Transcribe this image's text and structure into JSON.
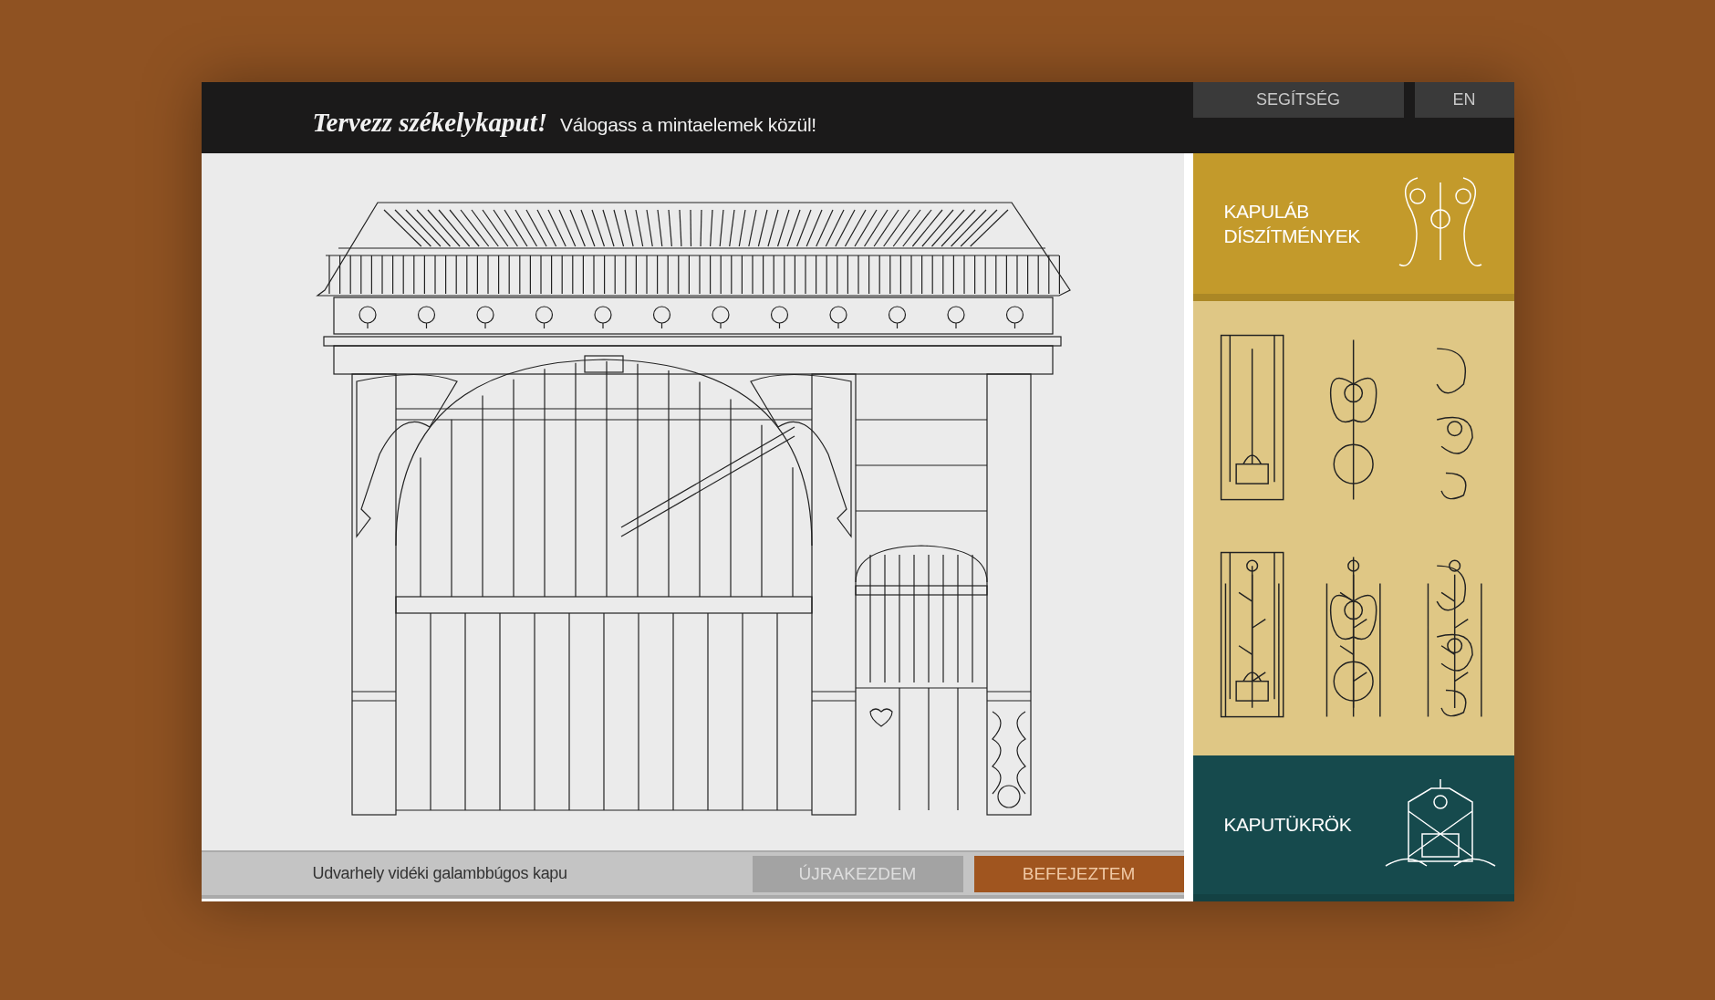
{
  "header": {
    "title": "Tervezz székelykaput!",
    "subtitle": "Válogass a mintaelemek közül!",
    "buttons": [
      {
        "label": "SEGÍTSÉG",
        "kind": "help"
      },
      {
        "label": "EN",
        "kind": "language"
      }
    ]
  },
  "canvas": {
    "gate_name": "Udvarhely vidéki galambbúgos kapu",
    "actions": [
      {
        "label": "ÚJRAKEZDEM",
        "kind": "secondary"
      },
      {
        "label": "BEFEJEZTEM",
        "kind": "primary"
      }
    ]
  },
  "sidebar": [
    {
      "kind": "category",
      "label": "KAPULÁB DÍSZÍTMÉNYEK",
      "color": "#c39a2b"
    },
    {
      "kind": "patterns",
      "color": "#dfc785"
    },
    {
      "kind": "category",
      "label": "KAPUTÜKRÖK",
      "color": "#164a4d"
    }
  ]
}
